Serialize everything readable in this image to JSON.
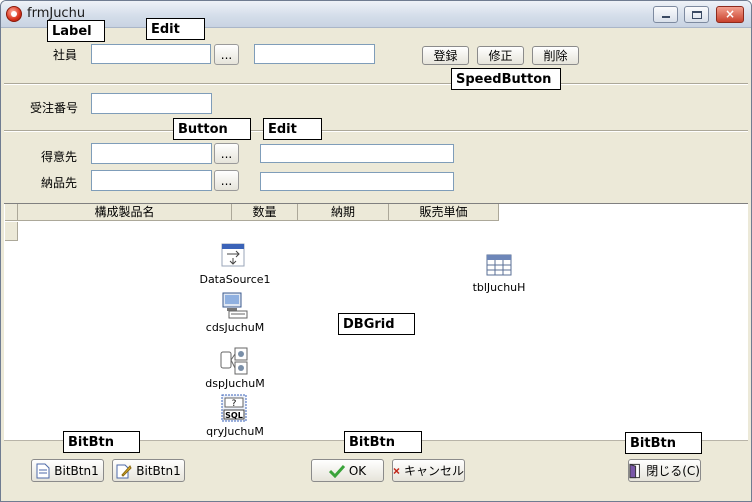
{
  "window": {
    "title": "frmJuchu",
    "min_label": "",
    "max_label": "",
    "close_label": "×"
  },
  "form": {
    "shain_label": "社員",
    "shain_lookup": "...",
    "register_btn": "登録",
    "modify_btn": "修正",
    "delete_btn": "削除",
    "juchu_no_label": "受注番号",
    "tokuisaki_label": "得意先",
    "tokuisaki_lookup": "...",
    "nohinsaki_label": "納品先",
    "nohinsaki_lookup": "..."
  },
  "grid": {
    "columns": [
      "構成製品名",
      "数量",
      "納期",
      "販売単価"
    ]
  },
  "components": {
    "datasource": "DataSource1",
    "cds": "cdsJuchuM",
    "dsp": "dspJuchuM",
    "qry": "qryJuchuM",
    "tbl": "tblJuchuH"
  },
  "buttons": {
    "bitbtn1a": "BitBtn1",
    "bitbtn1b": "BitBtn1",
    "ok": "OK",
    "cancel": "キャンセル",
    "close": "閉じる(C)"
  },
  "annotations": {
    "label": "Label",
    "edit_top": "Edit",
    "speedbutton": "SpeedButton",
    "button": "Button",
    "edit_mid": "Edit",
    "dbgrid": "DBGrid",
    "bitbtn_left": "BitBtn",
    "bitbtn_mid": "BitBtn",
    "bitbtn_right": "BitBtn"
  },
  "colors": {
    "ok_check": "#3aa33a",
    "cancel_x": "#c0281a"
  }
}
